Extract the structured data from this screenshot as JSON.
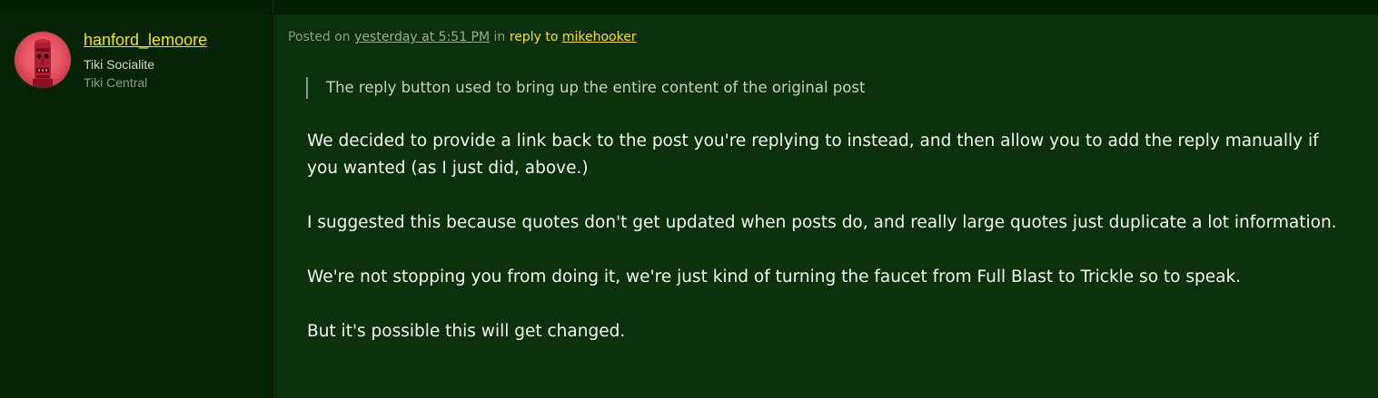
{
  "author": {
    "username": "hanford_lemoore",
    "title": "Tiki Socialite",
    "location": "Tiki Central",
    "avatar_icon": "tiki-mask-icon"
  },
  "post": {
    "posted_prefix": "Posted on",
    "timestamp": "yesterday at 5:51 PM",
    "in_word": "in",
    "reply_to_label": "reply to",
    "reply_to_user": "mikehooker",
    "quote": "The reply button used to bring up the entire content of the original post",
    "paragraphs": [
      "We decided to provide a link back to the post you're replying to instead, and then allow you to add the reply manually if you wanted (as I just did, above.)",
      "I suggested this because quotes don't get updated when posts do, and really large quotes just duplicate a lot information.",
      "We're not stopping you from doing it, we're just kind of turning the faucet from Full Blast to Trickle so to speak.",
      "But it's possible this will get changed."
    ]
  },
  "colors": {
    "background": "#0c300b",
    "sidebar": "#062306",
    "link": "#f2e030",
    "text": "#f4f6f2"
  }
}
